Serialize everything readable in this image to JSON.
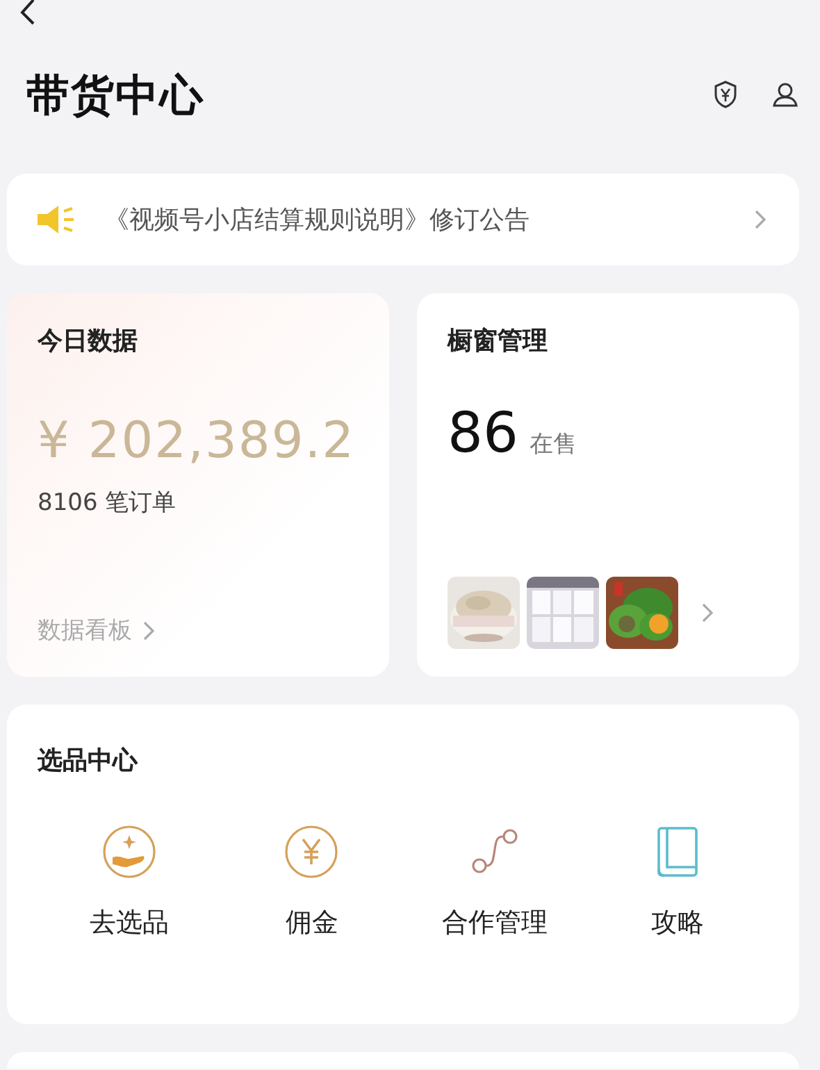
{
  "header": {
    "title": "带货中心"
  },
  "notice": {
    "text": "《视频号小店结算规则说明》修订公告"
  },
  "today_data": {
    "title": "今日数据",
    "amount": "¥ 202,389.2",
    "orders": "8106 笔订单",
    "link": "数据看板"
  },
  "showcase": {
    "title": "橱窗管理",
    "count": "86",
    "count_label": "在售"
  },
  "selection_center": {
    "title": "选品中心",
    "items": [
      {
        "label": "去选品",
        "kind": "hand"
      },
      {
        "label": "佣金",
        "kind": "coin"
      },
      {
        "label": "合作管理",
        "kind": "path"
      },
      {
        "label": "攻略",
        "kind": "book"
      }
    ]
  }
}
